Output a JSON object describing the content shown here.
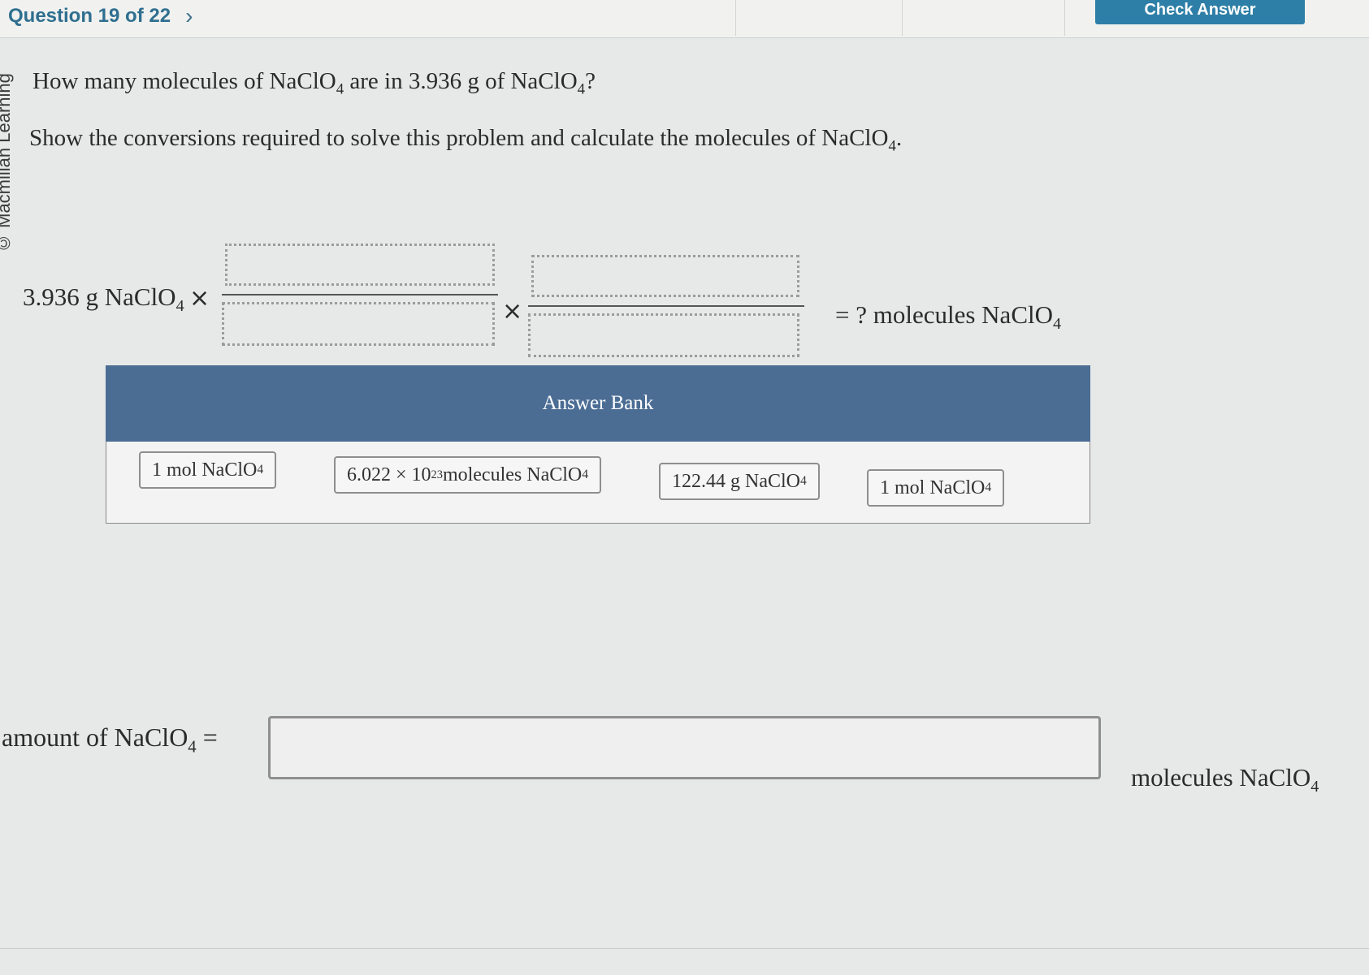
{
  "header": {
    "question_counter": "Question 19 of 22",
    "next_glyph": "›",
    "check_answer_label": "Check Answer"
  },
  "sidebar": {
    "brand_text": "© Macmillan Learning"
  },
  "question": {
    "line1_pre": "How many molecules of NaClO",
    "line1_sub1": "4",
    "line1_mid": " are in 3.936 g of NaClO",
    "line1_sub2": "4",
    "line1_end": "?",
    "line2_pre": "Show the conversions required to solve this problem and calculate the molecules of NaClO",
    "line2_sub": "4",
    "line2_end": "."
  },
  "equation": {
    "start_pre": "3.936 g NaClO",
    "start_sub": "4",
    "times_symbol": "×",
    "equals_pre": "=  ? molecules NaClO",
    "equals_sub": "4"
  },
  "answer_bank": {
    "title": "Answer Bank",
    "chip1_pre": "1 mol NaClO",
    "chip1_sub": "4",
    "chip2_mantissa": "6.022 × 10",
    "chip2_exp": "23",
    "chip2_post": " molecules NaClO",
    "chip2_sub": "4",
    "chip3_pre": "122.44 g NaClO",
    "chip3_sub": "4",
    "chip4_pre": "1 mol NaClO",
    "chip4_sub": "4"
  },
  "amount": {
    "label_pre": "amount of NaClO",
    "label_sub": "4",
    "label_eq": " =",
    "input_value": "",
    "unit_pre": "molecules NaClO",
    "unit_sub": "4"
  }
}
